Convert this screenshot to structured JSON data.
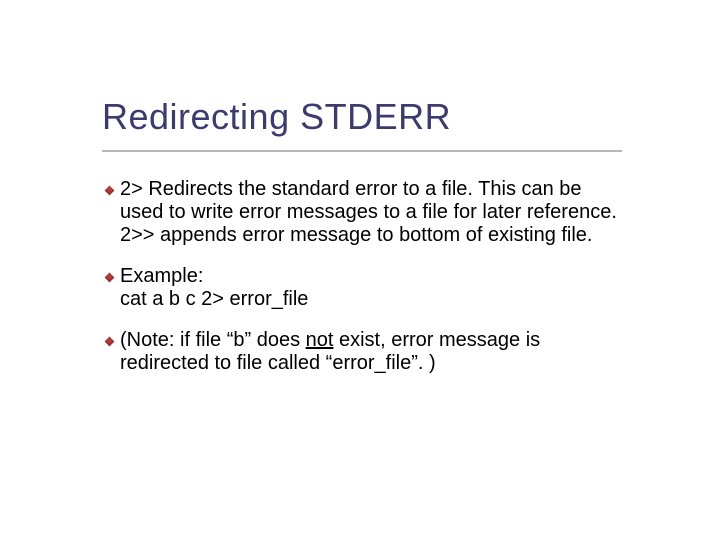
{
  "title": "Redirecting STDERR",
  "body": {
    "p1_a": "2>  Redirects the standard error to a file. This can be used to write error messages to a file for later reference.",
    "p1_b": "2>> appends error message to bottom of existing file.",
    "p2_a": "Example:",
    "p2_b": " cat  a  b  c 2> error_file",
    "p3_a": "(Note: if file “b” does ",
    "p3_not": "not",
    "p3_b": " exist, error message is redirected to file called “error_file”. )"
  }
}
